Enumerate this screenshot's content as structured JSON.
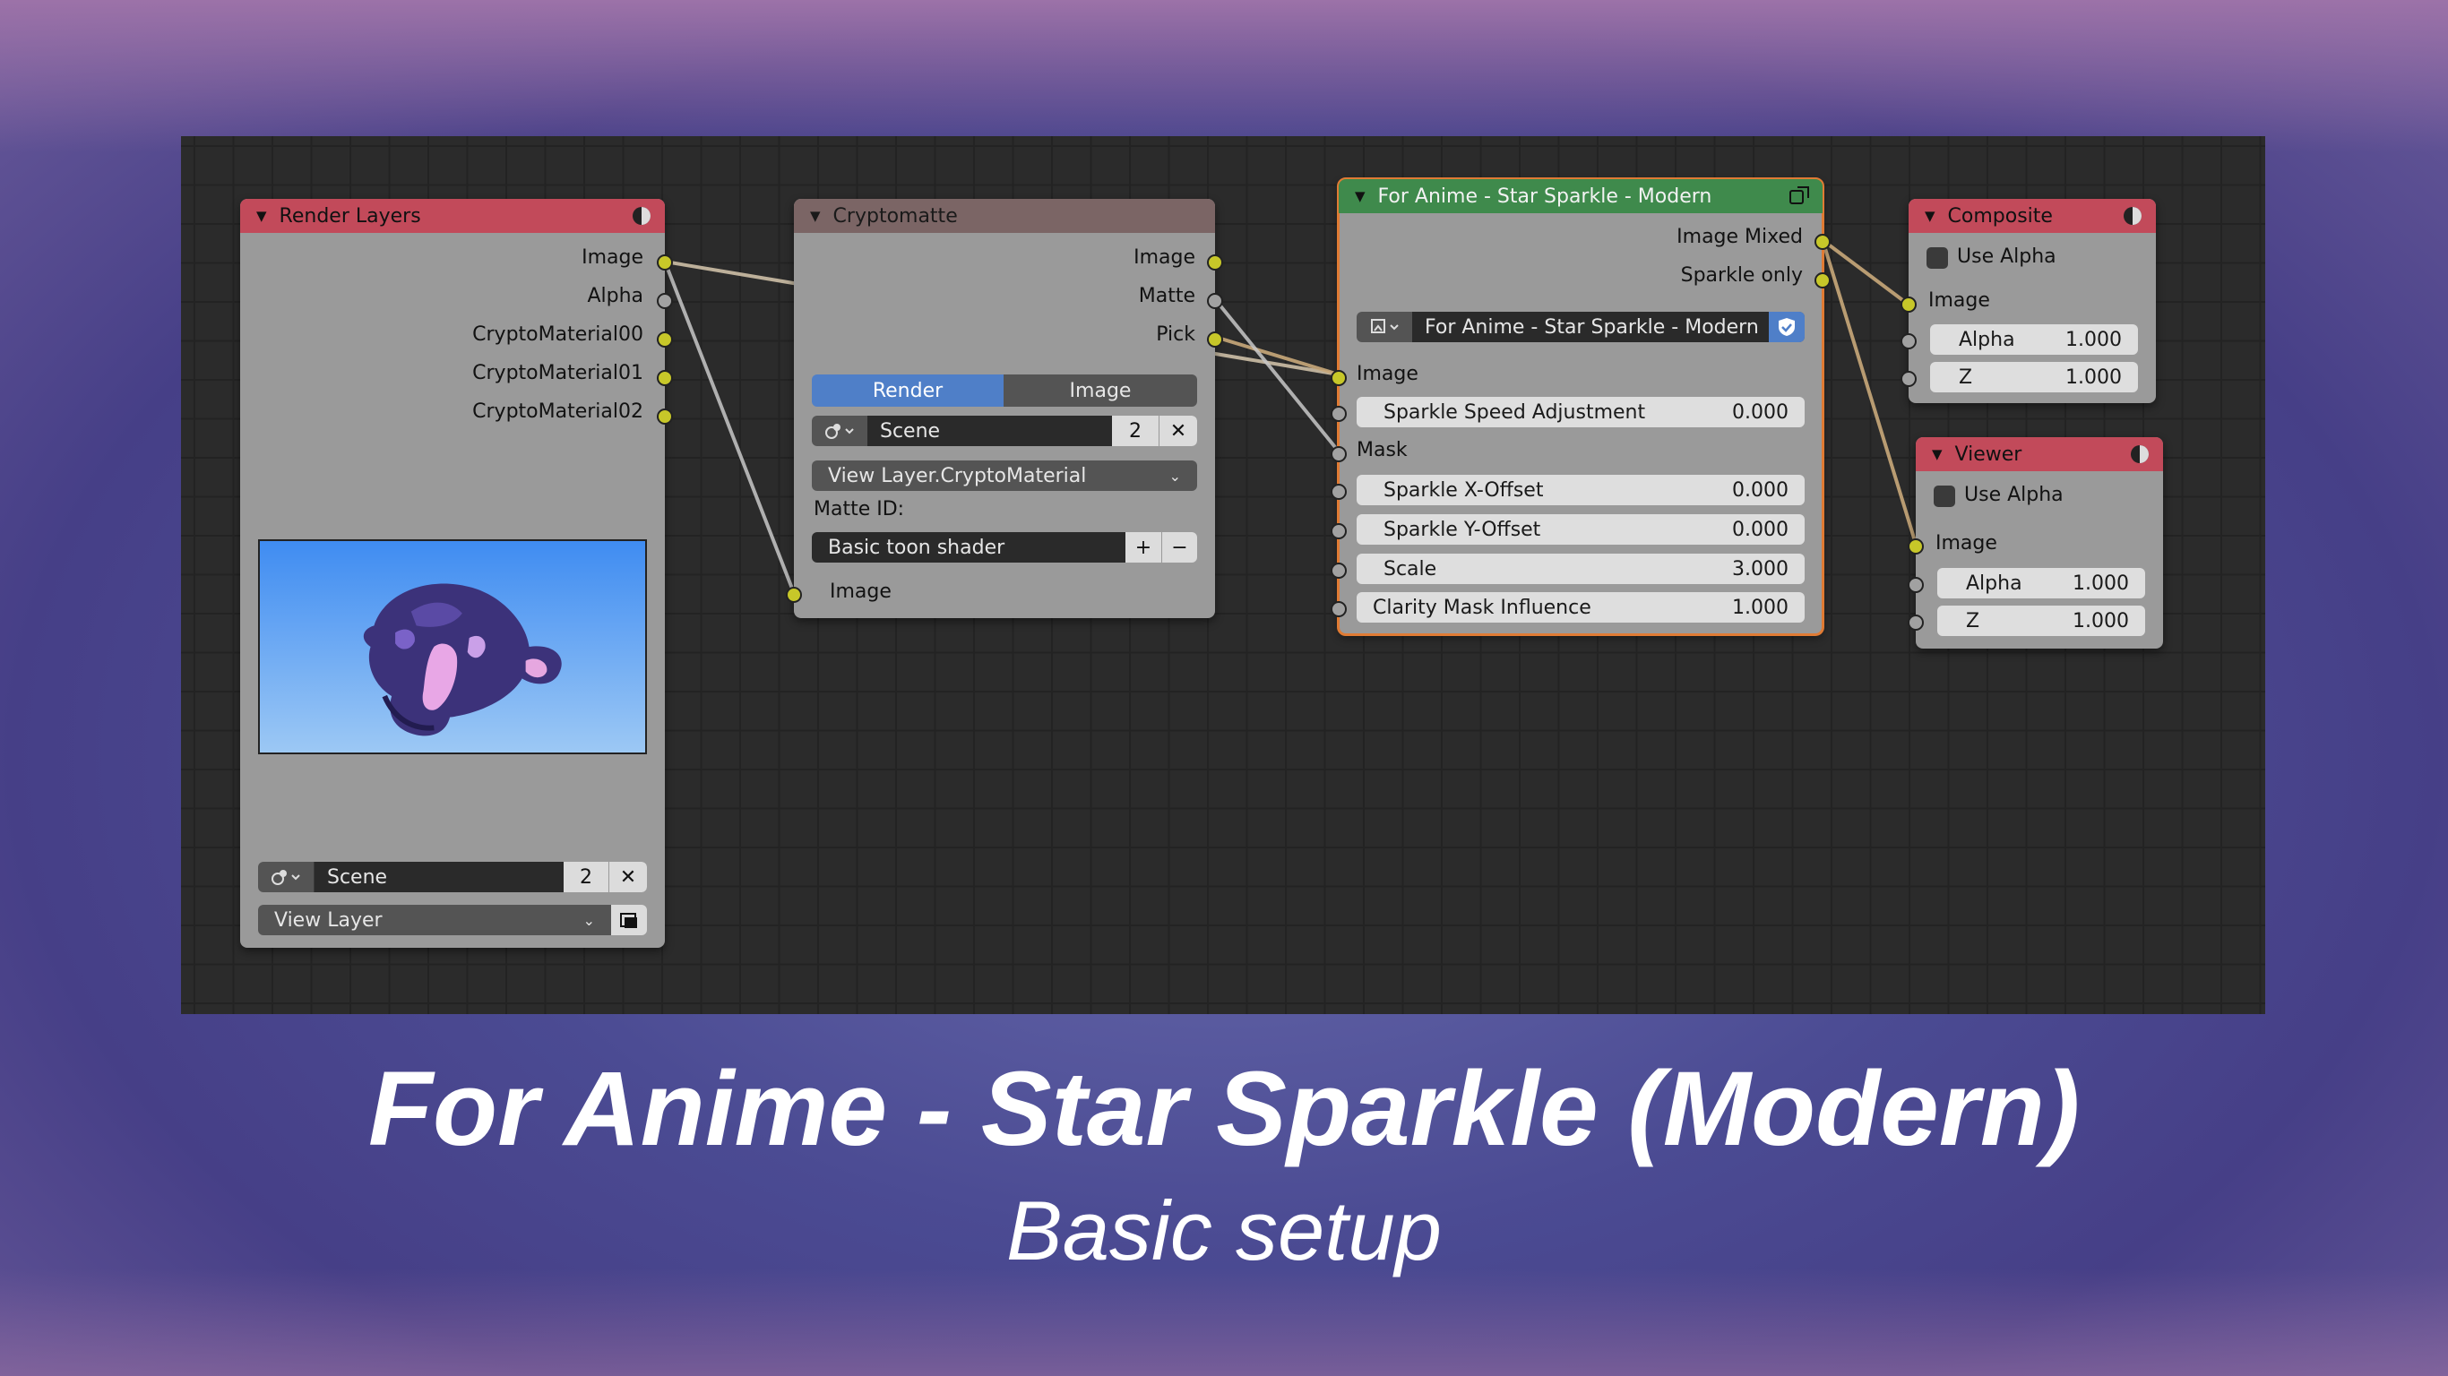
{
  "render_layers": {
    "title": "Render Layers",
    "outputs": [
      "Image",
      "Alpha",
      "CryptoMaterial00",
      "CryptoMaterial01",
      "CryptoMaterial02"
    ],
    "scene_label": "Scene",
    "scene_users": "2",
    "view_layer": "View Layer"
  },
  "cryptomatte": {
    "title": "Cryptomatte",
    "outputs": [
      "Image",
      "Matte",
      "Pick"
    ],
    "tabs": [
      "Render",
      "Image"
    ],
    "scene_label": "Scene",
    "scene_users": "2",
    "layer": "View Layer.CryptoMaterial",
    "matte_id_label": "Matte ID:",
    "matte_id": "Basic toon shader",
    "input": "Image"
  },
  "sparkle": {
    "title": "For Anime - Star Sparkle - Modern",
    "outputs": [
      "Image Mixed",
      "Sparkle only"
    ],
    "group_name": "For Anime - Star Sparkle - Modern",
    "image_label": "Image",
    "mask_label": "Mask",
    "params": [
      {
        "label": "Sparkle Speed Adjustment",
        "value": "0.000"
      },
      {
        "label": "Sparkle X-Offset",
        "value": "0.000"
      },
      {
        "label": "Sparkle Y-Offset",
        "value": "0.000"
      },
      {
        "label": "Scale",
        "value": "3.000"
      },
      {
        "label": "Clarity Mask Influence",
        "value": "1.000"
      }
    ]
  },
  "composite": {
    "title": "Composite",
    "use_alpha": "Use Alpha",
    "image_label": "Image",
    "alpha": {
      "label": "Alpha",
      "value": "1.000"
    },
    "z": {
      "label": "Z",
      "value": "1.000"
    }
  },
  "viewer": {
    "title": "Viewer",
    "use_alpha": "Use Alpha",
    "image_label": "Image",
    "alpha": {
      "label": "Alpha",
      "value": "1.000"
    },
    "z": {
      "label": "Z",
      "value": "1.000"
    }
  },
  "caption": {
    "title": "For Anime - Star Sparkle (Modern)",
    "subtitle": "Basic setup"
  },
  "colors": {
    "header_red": "#c24a5a",
    "header_green": "#3f8a4c",
    "header_brown": "#7b6565",
    "socket_yellow": "#c7c729",
    "socket_gray": "#a1a1a1",
    "selected_tab": "#4f7fc8"
  }
}
